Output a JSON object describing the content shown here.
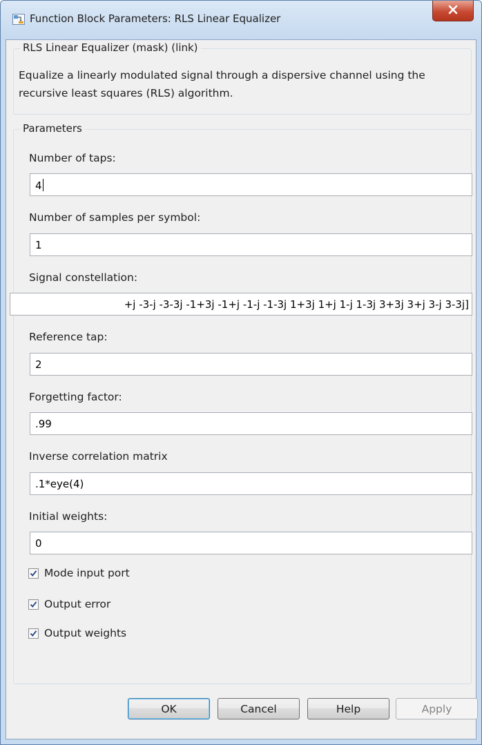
{
  "window": {
    "title": "Function Block Parameters: RLS Linear Equalizer"
  },
  "description_group": {
    "title": "RLS Linear Equalizer (mask) (link)",
    "text": "Equalize a linearly modulated signal through a dispersive channel using the recursive least squares (RLS) algorithm."
  },
  "parameters_group": {
    "title": "Parameters",
    "fields": [
      {
        "label": "Number of taps:",
        "value": "4"
      },
      {
        "label": "Number of samples per symbol:",
        "value": "1"
      },
      {
        "label": "Signal constellation:",
        "value": "+j -3-j -3-3j -1+3j -1+j -1-j -1-3j 1+3j 1+j 1-j 1-3j 3+3j 3+j 3-j 3-3j]"
      },
      {
        "label": "Reference tap:",
        "value": "2"
      },
      {
        "label": "Forgetting factor:",
        "value": ".99"
      },
      {
        "label": "Inverse correlation matrix",
        "value": ".1*eye(4)"
      },
      {
        "label": "Initial weights:",
        "value": "0"
      }
    ],
    "checkboxes": [
      {
        "label": "Mode input port",
        "checked": true
      },
      {
        "label": "Output error",
        "checked": true
      },
      {
        "label": "Output weights",
        "checked": true
      }
    ]
  },
  "buttons": {
    "ok": "OK",
    "cancel": "Cancel",
    "help": "Help",
    "apply": "Apply"
  },
  "colors": {
    "title_bar": "#c5d9ef",
    "close_button": "#c74a33",
    "dialog_background": "#f0f0f0"
  }
}
